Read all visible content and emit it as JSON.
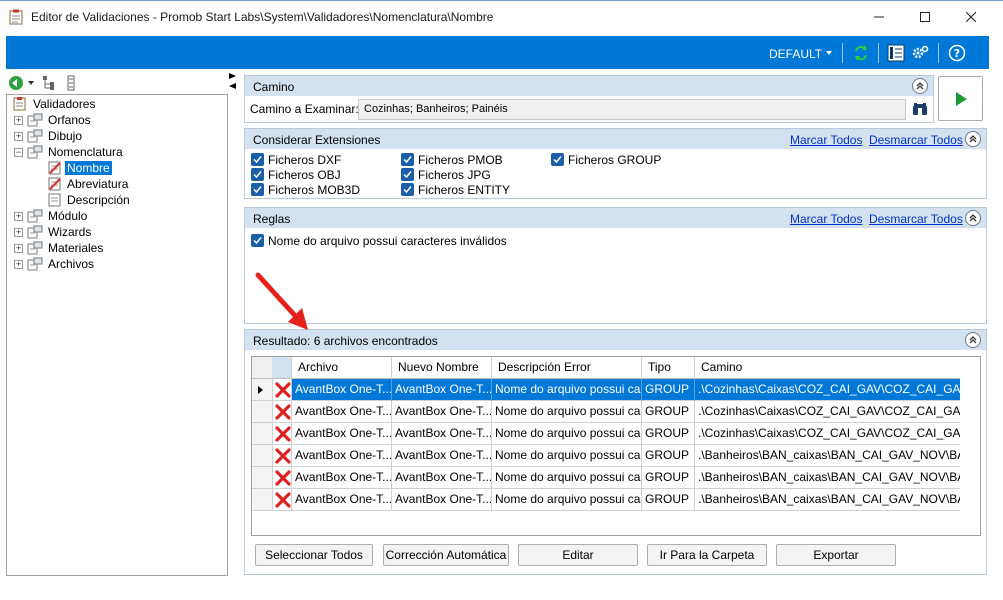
{
  "window": {
    "title": "Editor de Validaciones - Promob Start Labs\\System\\Validadores\\Nomenclatura\\Nombre"
  },
  "toolbar": {
    "profile": "DEFAULT",
    "accent": "#0078d7"
  },
  "tree": {
    "root": "Validadores",
    "items": [
      {
        "label": "Orfanos"
      },
      {
        "label": "Dibujo"
      },
      {
        "label": "Nomenclatura"
      },
      {
        "label": "Nombre"
      },
      {
        "label": "Abreviatura"
      },
      {
        "label": "Descripción"
      },
      {
        "label": "Módulo"
      },
      {
        "label": "Wizards"
      },
      {
        "label": "Materiales"
      },
      {
        "label": "Archivos"
      }
    ]
  },
  "camino": {
    "title": "Camino",
    "label": "Camino a Examinar:",
    "value": "Cozinhas; Banheiros; Painéis"
  },
  "extensiones": {
    "title": "Considerar Extensiones",
    "mark_all": "Marcar Todos",
    "unmark_all": "Desmarcar Todos",
    "options": [
      "Ficheros DXF",
      "Ficheros OBJ",
      "Ficheros MOB3D",
      "Ficheros PMOB",
      "Ficheros JPG",
      "Ficheros ENTITY",
      "Ficheros GROUP"
    ]
  },
  "reglas": {
    "title": "Reglas",
    "mark_all": "Marcar Todos",
    "unmark_all": "Desmarcar Todos",
    "rule": "Nome do arquivo possui caracteres inválidos"
  },
  "resultado": {
    "label": "Resultado:",
    "count": "6 archivos encontrados",
    "columns": [
      "Archivo",
      "Nuevo Nombre",
      "Descripción Error",
      "Tipo",
      "Camino"
    ],
    "rows": [
      [
        "AvantBox One-T...",
        "AvantBox One-T...",
        "Nome do arquivo possui car...",
        "GROUP",
        ".\\Cozinhas\\Caixas\\COZ_CAI_GAV\\COZ_CAI_GAV..."
      ],
      [
        "AvantBox One-T...",
        "AvantBox One-T...",
        "Nome do arquivo possui car...",
        "GROUP",
        ".\\Cozinhas\\Caixas\\COZ_CAI_GAV\\COZ_CAI_GAV..."
      ],
      [
        "AvantBox One-T...",
        "AvantBox One-T...",
        "Nome do arquivo possui car...",
        "GROUP",
        ".\\Cozinhas\\Caixas\\COZ_CAI_GAV\\COZ_CAI_GAV..."
      ],
      [
        "AvantBox One-T...",
        "AvantBox One-T...",
        "Nome do arquivo possui car...",
        "GROUP",
        ".\\Banheiros\\BAN_caixas\\BAN_CAI_GAV_NOV\\BA..."
      ],
      [
        "AvantBox One-T...",
        "AvantBox One-T...",
        "Nome do arquivo possui car...",
        "GROUP",
        ".\\Banheiros\\BAN_caixas\\BAN_CAI_GAV_NOV\\BA..."
      ],
      [
        "AvantBox One-T...",
        "AvantBox One-T...",
        "Nome do arquivo possui car...",
        "GROUP",
        ".\\Banheiros\\BAN_caixas\\BAN_CAI_GAV_NOV\\BA..."
      ]
    ]
  },
  "buttons": {
    "select_all": "Seleccionar Todos",
    "auto_fix": "Corrección Automática",
    "edit": "Editar",
    "go_folder": "Ir Para la Carpeta",
    "export": "Exportar"
  }
}
